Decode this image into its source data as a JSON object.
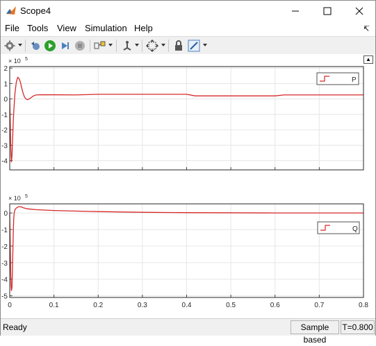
{
  "window": {
    "title": "Scope4"
  },
  "menu": [
    {
      "label": "File"
    },
    {
      "label": "Tools"
    },
    {
      "label": "View"
    },
    {
      "label": "Simulation"
    },
    {
      "label": "Help"
    }
  ],
  "toolbar_icons": [
    "gear-icon",
    "restore-config-icon",
    "run-icon",
    "step-forward-icon",
    "stop-icon",
    "highlight-block-icon",
    "triggers-icon",
    "zoom-fit-icon",
    "lock-axes-icon",
    "style-icon"
  ],
  "status": {
    "left": "Ready",
    "mode": "Sample based",
    "time": "T=0.800"
  },
  "colors": {
    "signal": "#d62728",
    "accent_run": "#2ca02c"
  },
  "chart_data": [
    {
      "type": "line",
      "exponent_label": "× 10",
      "exponent": "5",
      "xlim": [
        0,
        0.8
      ],
      "ylim": [
        -4.6,
        2.1
      ],
      "yticks": [
        2,
        1,
        0,
        -1,
        -2,
        -3,
        -4
      ],
      "xticks": [
        0,
        0.1,
        0.2,
        0.3,
        0.4,
        0.5,
        0.6,
        0.7,
        0.8
      ],
      "grid": true,
      "legend_position": "top-right",
      "series": [
        {
          "name": "P",
          "x": [
            0,
            0.001,
            0.002,
            0.003,
            0.004,
            0.005,
            0.006,
            0.007,
            0.008,
            0.01,
            0.012,
            0.015,
            0.018,
            0.021,
            0.024,
            0.027,
            0.03,
            0.033,
            0.036,
            0.04,
            0.045,
            0.05,
            0.055,
            0.06,
            0.07,
            0.08,
            0.1,
            0.15,
            0.2,
            0.25,
            0.3,
            0.35,
            0.4,
            0.42,
            0.5,
            0.6,
            0.62,
            0.7,
            0.8
          ],
          "y": [
            0,
            -1.2,
            -2.8,
            -3.6,
            -4.1,
            -3.7,
            -3.0,
            -2.2,
            -1.4,
            -0.4,
            0.4,
            1.1,
            1.4,
            1.32,
            1.1,
            0.72,
            0.4,
            0.15,
            0.02,
            -0.05,
            0.02,
            0.12,
            0.22,
            0.26,
            0.27,
            0.27,
            0.27,
            0.26,
            0.3,
            0.3,
            0.3,
            0.3,
            0.3,
            0.2,
            0.2,
            0.2,
            0.26,
            0.26,
            0.26
          ]
        }
      ]
    },
    {
      "type": "line",
      "exponent_label": "× 10",
      "exponent": "5",
      "xlim": [
        0,
        0.8
      ],
      "ylim": [
        -5.1,
        0.55
      ],
      "yticks": [
        0,
        -1,
        -2,
        -3,
        -4,
        -5
      ],
      "xticks": [
        0,
        0.1,
        0.2,
        0.3,
        0.4,
        0.5,
        0.6,
        0.7,
        0.8
      ],
      "xtick_labels": [
        "0",
        "0.1",
        "0.2",
        "0.3",
        "0.4",
        "0.5",
        "0.6",
        "0.7",
        "0.8"
      ],
      "grid": true,
      "legend_position": "right",
      "series": [
        {
          "name": "Q",
          "x": [
            0,
            0.001,
            0.002,
            0.003,
            0.004,
            0.005,
            0.006,
            0.007,
            0.008,
            0.009,
            0.01,
            0.012,
            0.015,
            0.02,
            0.025,
            0.03,
            0.04,
            0.06,
            0.1,
            0.2,
            0.3,
            0.4,
            0.6,
            0.8
          ],
          "y": [
            0,
            -1.5,
            -3.4,
            -4.4,
            -4.7,
            -4.5,
            -3.6,
            -2.3,
            -1.2,
            -0.4,
            0.0,
            0.2,
            0.3,
            0.38,
            0.38,
            0.32,
            0.25,
            0.2,
            0.15,
            0.08,
            0.04,
            0.02,
            0.0,
            0.0
          ]
        }
      ]
    }
  ]
}
